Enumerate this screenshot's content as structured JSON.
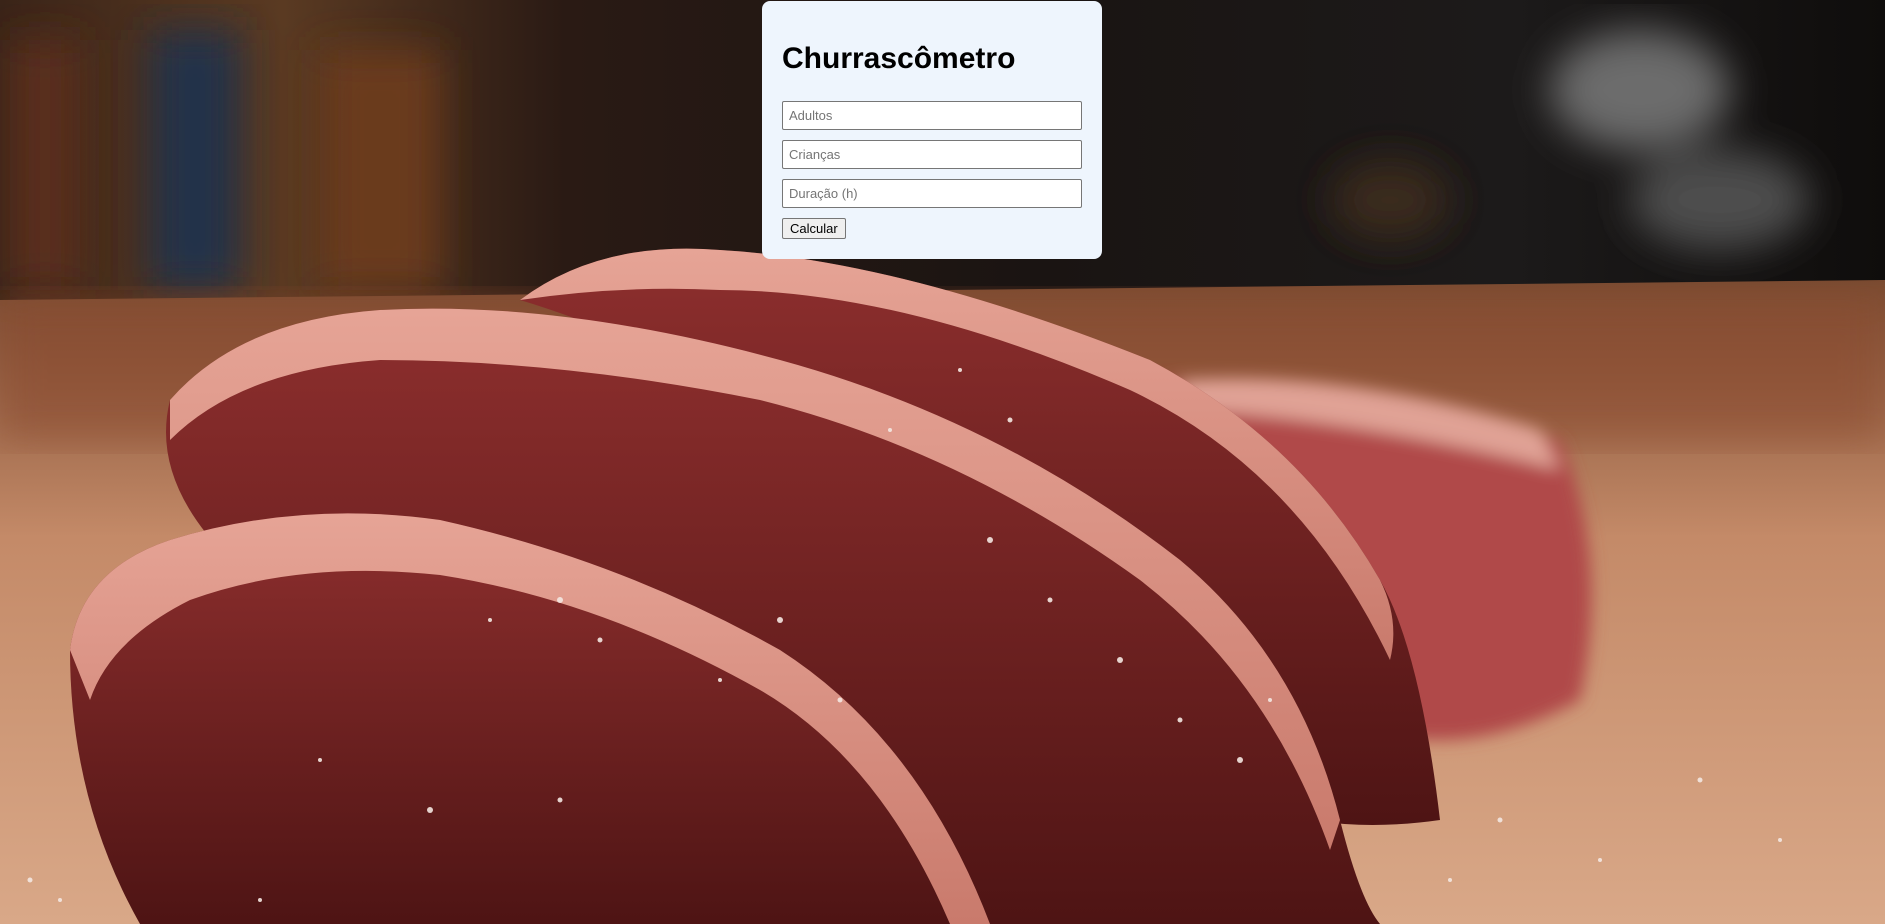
{
  "title": "Churrascômetro",
  "inputs": {
    "adults_placeholder": "Adultos",
    "children_placeholder": "Crianças",
    "duration_placeholder": "Duração (h)"
  },
  "button_label": "Calcular",
  "colors": {
    "card_background": "#eef5fd"
  }
}
